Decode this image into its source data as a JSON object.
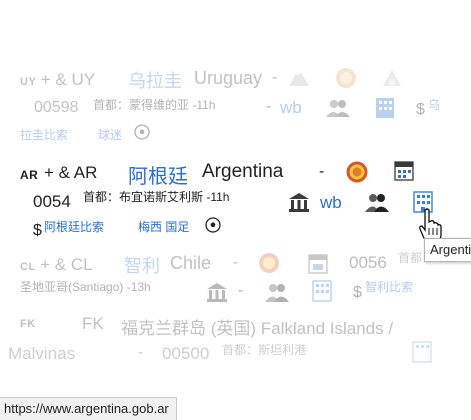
{
  "uruguay": {
    "code": "UY",
    "code_plus": "+ & UY",
    "name_cn": "乌拉圭",
    "name_en": "Uruguay",
    "dash": "-",
    "dial": "00598",
    "capital": "首都：蒙得维的亚 -11h",
    "dash2": "-",
    "wb": "wb",
    "currency": "$",
    "currency_link": "乌",
    "compare_link": "拉圭比索",
    "fans_link": "球迷"
  },
  "argentina": {
    "code": "AR",
    "code_plus": "+ & AR",
    "name_cn": "阿根廷",
    "name_en": "Argentina",
    "dash": "-",
    "dial": "0054",
    "capital": "首都：布宜诺斯艾利斯 -11h",
    "wb": "wb",
    "currency": "$",
    "currency_link": "阿根廷比索",
    "football_link": "梅西 国足"
  },
  "chile": {
    "code": "CL",
    "code_plus": "+ & CL",
    "name_cn": "智利",
    "name_en": "Chile",
    "dash": "-",
    "dial": "0056",
    "capital_partial": "首都",
    "capital": "圣地亚哥(Santiago) -13h",
    "currency": "$",
    "currency_link": "智利比索"
  },
  "falkland": {
    "code": "FK",
    "code2": "FK",
    "name": "福克兰群岛 (英国) Falkland Islands /",
    "name_cont": "Malvinas",
    "dash": "-",
    "dial": "00500",
    "capital": "首都：斯坦利港"
  },
  "tooltip": "Argentina",
  "status_url": "https://www.argentina.gob.ar"
}
